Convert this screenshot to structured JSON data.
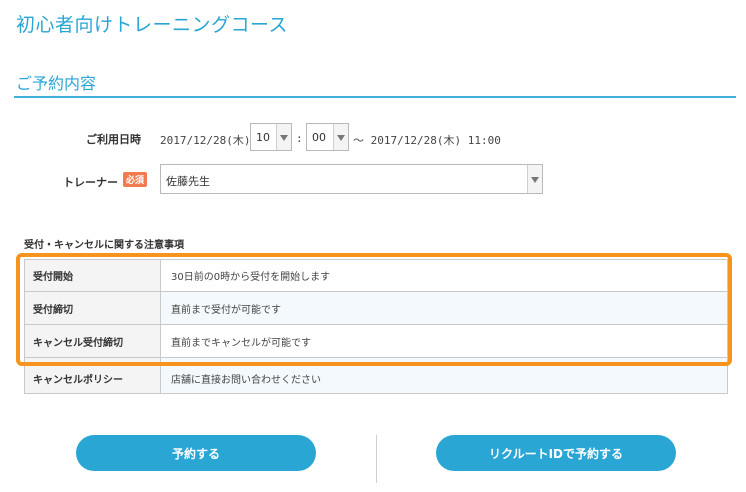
{
  "page": {
    "title": "初心者向けトレーニングコース",
    "section_title": "ご予約内容"
  },
  "form": {
    "datetime_label": "ご利用日時",
    "start_date": "2017/12/28(木)",
    "hour_value": "10",
    "time_separator": ":",
    "minute_value": "00",
    "end_text": "～ 2017/12/28(木) 11:00",
    "trainer_label": "トレーナー",
    "required_badge": "必須",
    "trainer_value": "佐藤先生"
  },
  "notes": {
    "heading": "受付・キャンセルに関する注意事項",
    "rows": [
      {
        "label": "受付開始",
        "value": "30日前の0時から受付を開始します"
      },
      {
        "label": "受付締切",
        "value": "直前まで受付が可能です"
      },
      {
        "label": "キャンセル受付締切",
        "value": "直前までキャンセルが可能です"
      },
      {
        "label": "キャンセルポリシー",
        "value": "店舗に直接お問い合わせください"
      }
    ]
  },
  "actions": {
    "reserve_label": "予約する",
    "recruit_reserve_label": "リクルートIDで予約する"
  },
  "colors": {
    "accent": "#2aa6d5",
    "highlight": "#f7941d",
    "required": "#f07b4f"
  }
}
